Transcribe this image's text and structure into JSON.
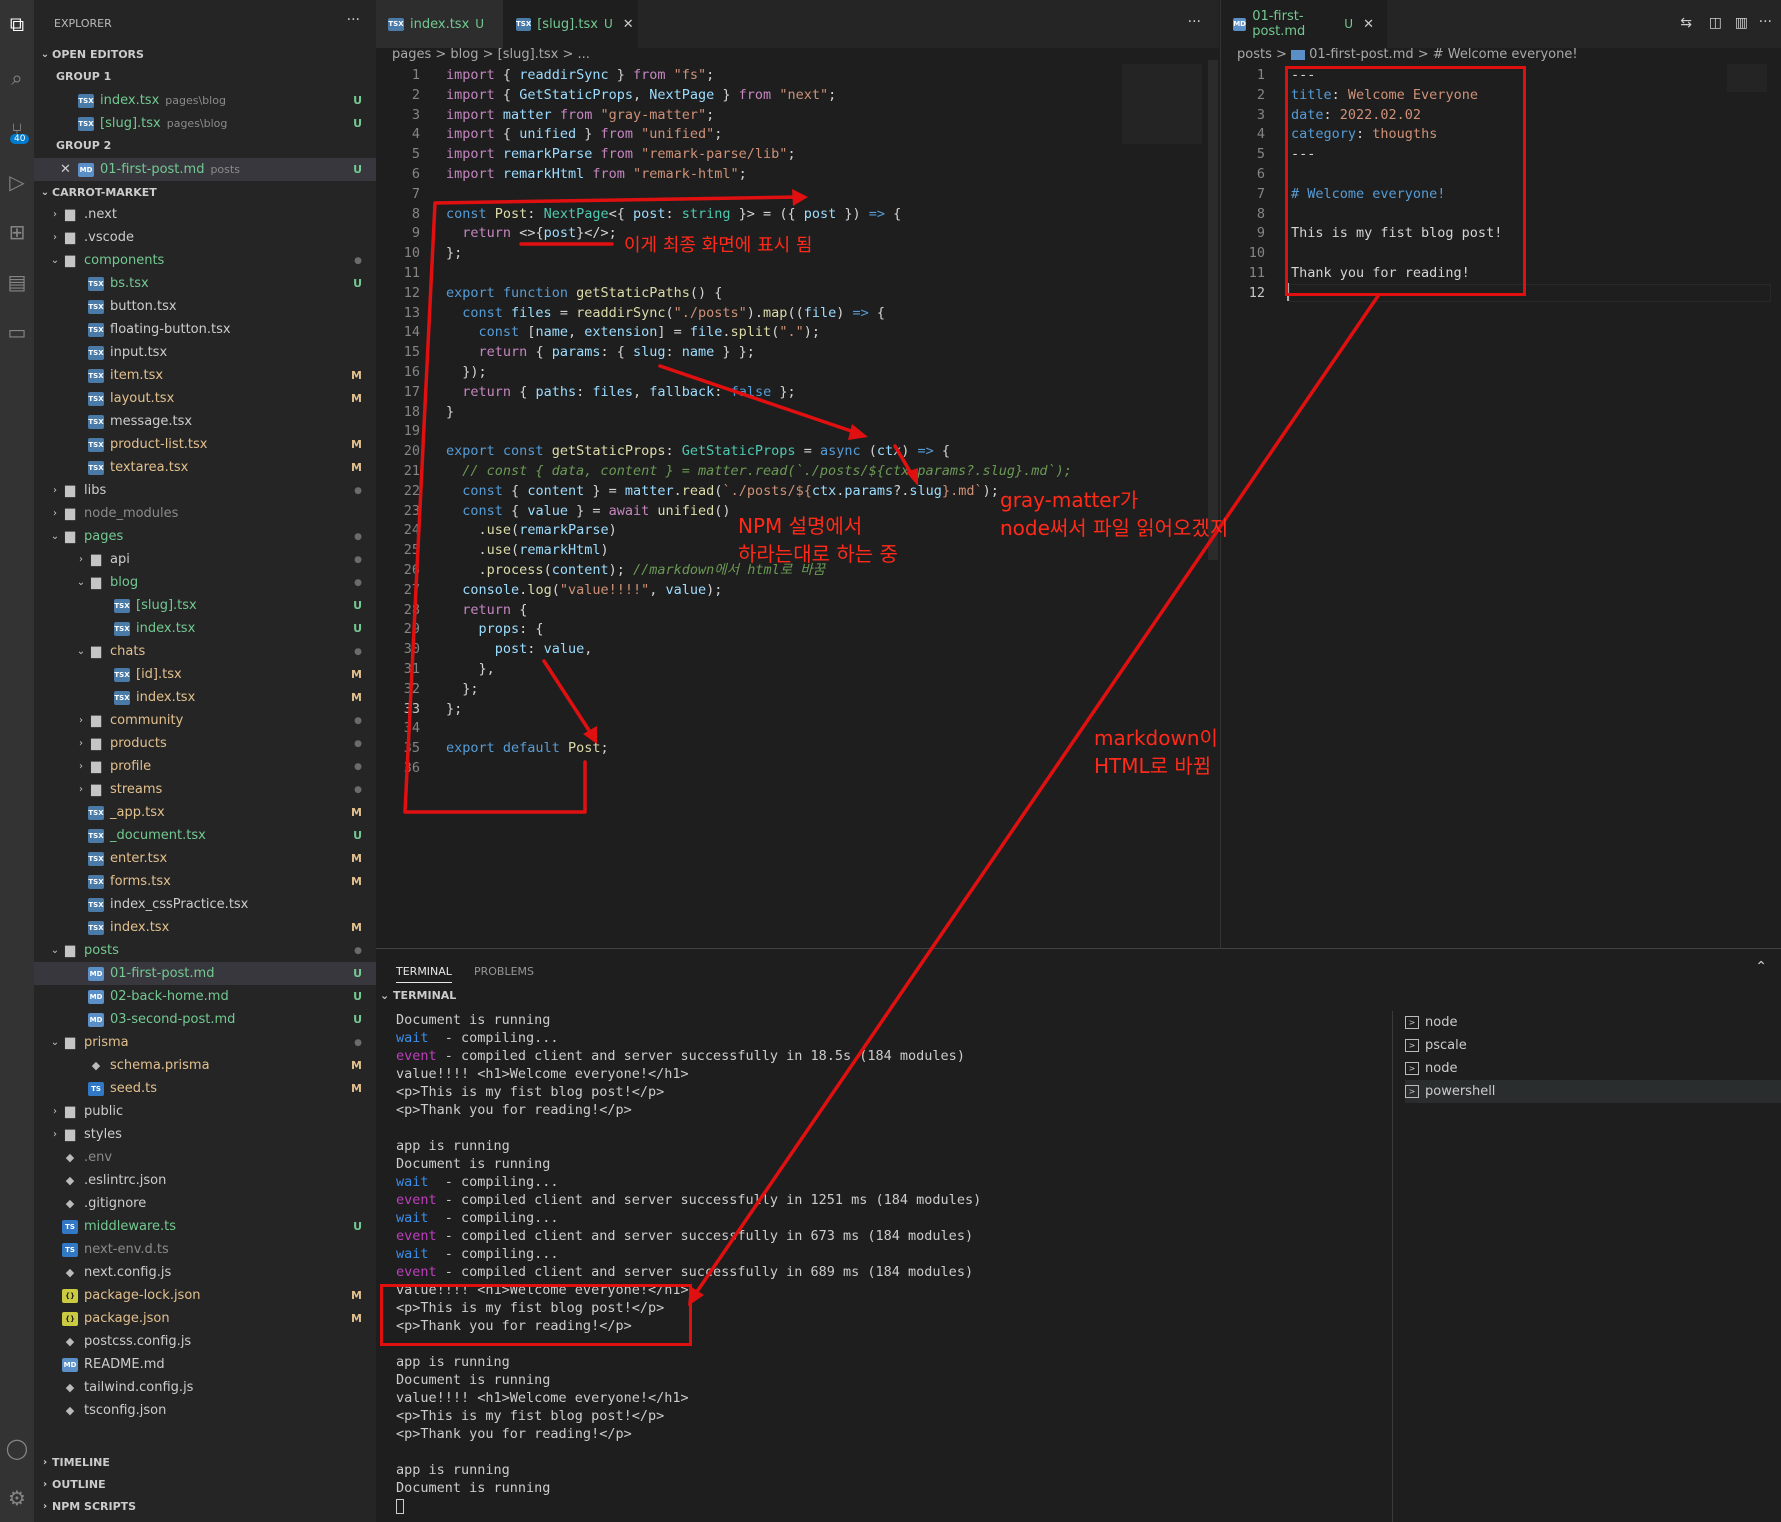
{
  "activity_bar": {
    "scm_badge": "40"
  },
  "sidebar": {
    "title": "EXPLORER",
    "more": "···",
    "open_editors": {
      "label": "OPEN EDITORS",
      "group1": "GROUP 1",
      "group2": "GROUP 2",
      "items": [
        {
          "name": "index.tsx",
          "path": "pages\\blog",
          "badge": "U"
        },
        {
          "name": "[slug].tsx",
          "path": "pages\\blog",
          "badge": "U"
        },
        {
          "name": "01-first-post.md",
          "path": "posts",
          "badge": "U"
        }
      ]
    },
    "project": "CARROT-MARKET",
    "tree": [
      {
        "name": ".next",
        "badge": ""
      },
      {
        "name": ".vscode",
        "badge": ""
      },
      {
        "name": "components",
        "badge": "●"
      },
      {
        "name": "bs.tsx",
        "badge": "U"
      },
      {
        "name": "button.tsx",
        "badge": ""
      },
      {
        "name": "floating-button.tsx",
        "badge": ""
      },
      {
        "name": "input.tsx",
        "badge": ""
      },
      {
        "name": "item.tsx",
        "badge": "M"
      },
      {
        "name": "layout.tsx",
        "badge": "M"
      },
      {
        "name": "message.tsx",
        "badge": ""
      },
      {
        "name": "product-list.tsx",
        "badge": "M"
      },
      {
        "name": "textarea.tsx",
        "badge": "M"
      },
      {
        "name": "libs",
        "badge": "●"
      },
      {
        "name": "node_modules",
        "badge": ""
      },
      {
        "name": "pages",
        "badge": "●"
      },
      {
        "name": "api",
        "badge": "●"
      },
      {
        "name": "blog",
        "badge": "●"
      },
      {
        "name": "[slug].tsx",
        "badge": "U"
      },
      {
        "name": "index.tsx",
        "badge": "U"
      },
      {
        "name": "chats",
        "badge": "●"
      },
      {
        "name": "[id].tsx",
        "badge": "M"
      },
      {
        "name": "index.tsx",
        "badge": "M"
      },
      {
        "name": "community",
        "badge": "●"
      },
      {
        "name": "products",
        "badge": "●"
      },
      {
        "name": "profile",
        "badge": "●"
      },
      {
        "name": "streams",
        "badge": "●"
      },
      {
        "name": "_app.tsx",
        "badge": "M"
      },
      {
        "name": "_document.tsx",
        "badge": "U"
      },
      {
        "name": "enter.tsx",
        "badge": "M"
      },
      {
        "name": "forms.tsx",
        "badge": "M"
      },
      {
        "name": "index_cssPractice.tsx",
        "badge": ""
      },
      {
        "name": "index.tsx",
        "badge": "M"
      },
      {
        "name": "posts",
        "badge": "●"
      },
      {
        "name": "01-first-post.md",
        "badge": "U"
      },
      {
        "name": "02-back-home.md",
        "badge": "U"
      },
      {
        "name": "03-second-post.md",
        "badge": "U"
      },
      {
        "name": "prisma",
        "badge": "●"
      },
      {
        "name": "schema.prisma",
        "badge": "M"
      },
      {
        "name": "seed.ts",
        "badge": "M"
      },
      {
        "name": "public",
        "badge": ""
      },
      {
        "name": "styles",
        "badge": ""
      },
      {
        "name": ".env",
        "badge": ""
      },
      {
        "name": ".eslintrc.json",
        "badge": ""
      },
      {
        "name": ".gitignore",
        "badge": ""
      },
      {
        "name": "middleware.ts",
        "badge": "U"
      },
      {
        "name": "next-env.d.ts",
        "badge": ""
      },
      {
        "name": "next.config.js",
        "badge": ""
      },
      {
        "name": "package-lock.json",
        "badge": "M"
      },
      {
        "name": "package.json",
        "badge": "M"
      },
      {
        "name": "postcss.config.js",
        "badge": ""
      },
      {
        "name": "README.md",
        "badge": ""
      },
      {
        "name": "tailwind.config.js",
        "badge": ""
      },
      {
        "name": "tsconfig.json",
        "badge": ""
      }
    ],
    "bottom_sections": [
      "TIMELINE",
      "OUTLINE",
      "NPM SCRIPTS"
    ]
  },
  "editor_left": {
    "tabs": [
      {
        "name": "index.tsx",
        "badge": "U"
      },
      {
        "name": "[slug].tsx",
        "badge": "U"
      }
    ],
    "more": "···",
    "breadcrumb": "pages > blog > [slug].tsx > ..."
  },
  "editor_right": {
    "tab": {
      "name": "01-first-post.md",
      "badge": "U"
    },
    "breadcrumb_a": "posts >",
    "breadcrumb_b": "01-first-post.md >",
    "breadcrumb_c": "# Welcome everyone!",
    "lines": [
      "---",
      "title: Welcome Everyone",
      "date: 2022.02.02",
      "category: thougths",
      "---",
      "",
      "# Welcome everyone!",
      "",
      "This is my fist blog post!",
      "",
      "Thank you for reading!",
      ""
    ]
  },
  "panel": {
    "tabs": [
      "TERMINAL",
      "PROBLEMS"
    ],
    "section": "TERMINAL",
    "shells": [
      "node",
      "pscale",
      "node",
      "powershell"
    ]
  },
  "annotations": {
    "final_display": "이게 최종 화면에 표시 됨",
    "gray_matter_1": "gray-matter가",
    "gray_matter_2": "node써서 파일 읽어오겠지",
    "npm_1": "NPM 설명에서",
    "npm_2": "하라는대로 하는 중",
    "md_html_1": "markdown이",
    "md_html_2": "HTML로 바뀜"
  }
}
